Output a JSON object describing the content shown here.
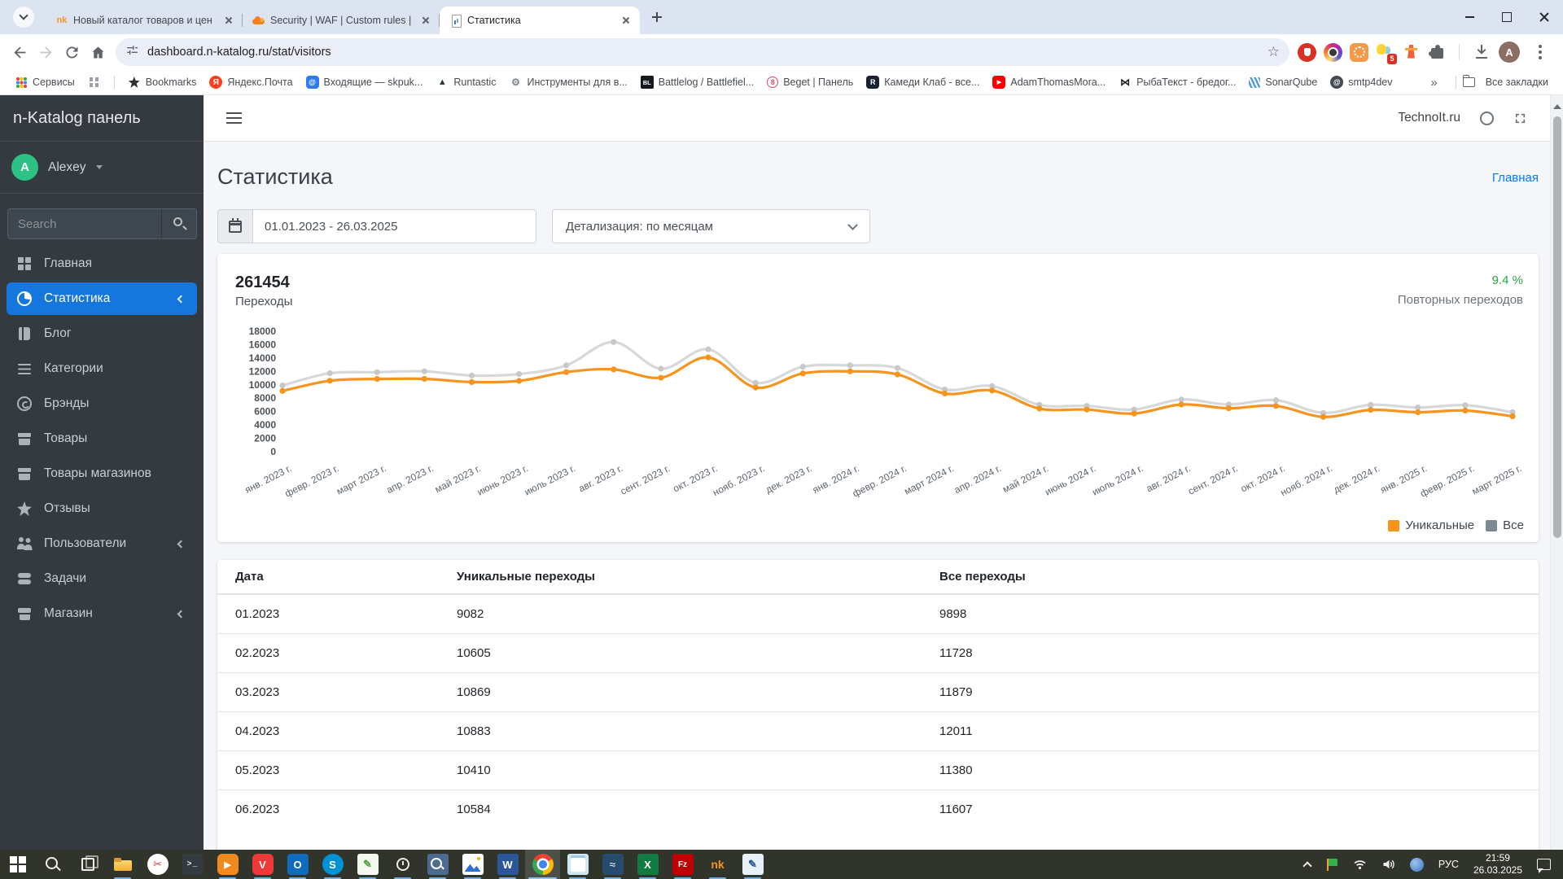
{
  "browser": {
    "tabs": [
      {
        "title": "Новый каталог товаров и цен",
        "favicon": "nk",
        "favicon_glyph": "nk",
        "active": false
      },
      {
        "title": "Security | WAF | Custom rules | ",
        "favicon": "cloudflare",
        "favicon_glyph": "",
        "active": false
      },
      {
        "title": "Статистика",
        "favicon": "stats",
        "favicon_glyph": "",
        "active": true
      }
    ],
    "url": "dashboard.n-katalog.ru/stat/visitors",
    "extension_badge": "5",
    "profile_initial": "A",
    "bookmarks": [
      {
        "label": "Сервисы",
        "icon": "google-apps",
        "glyph": ""
      },
      {
        "label": "",
        "icon": "grid-gray",
        "glyph": "",
        "divider_after": true
      },
      {
        "label": "Bookmarks",
        "icon": "star-black",
        "glyph": ""
      },
      {
        "label": "Яндекс.Почта",
        "icon": "ya-red",
        "glyph": "Я"
      },
      {
        "label": "Входящие — skpuk...",
        "icon": "at-blue",
        "glyph": "@"
      },
      {
        "label": "Runtastic",
        "icon": "runtastic",
        "glyph": "▲"
      },
      {
        "label": "Инструменты для в...",
        "icon": "tools",
        "glyph": "⚙"
      },
      {
        "label": "Battlelog / Battlefiel...",
        "icon": "bl-black",
        "glyph": "BL"
      },
      {
        "label": "Beget | Панель",
        "icon": "beget",
        "glyph": "8"
      },
      {
        "label": "Камеди Клаб - все...",
        "icon": "kk-dark",
        "glyph": "R"
      },
      {
        "label": "AdamThomasMora...",
        "icon": "youtube",
        "glyph": "▶"
      },
      {
        "label": "РыбаТекст - бредог...",
        "icon": "butterfly",
        "glyph": "⋈"
      },
      {
        "label": "SonarQube",
        "icon": "sonarqube",
        "glyph": ""
      },
      {
        "label": "smtp4dev",
        "icon": "smtp",
        "glyph": "@"
      }
    ],
    "overflow_glyph": "»",
    "all_bookmarks": "Все закладки"
  },
  "sidebar": {
    "brand": "n-Katalog панель",
    "user_initial": "A",
    "user_name": "Alexey",
    "search_placeholder": "Search",
    "items": [
      {
        "label": "Главная",
        "icon": "grid"
      },
      {
        "label": "Статистика",
        "icon": "chart-pie",
        "active": true,
        "chevron": true
      },
      {
        "label": "Блог",
        "icon": "book"
      },
      {
        "label": "Категории",
        "icon": "list"
      },
      {
        "label": "Брэнды",
        "icon": "copyright"
      },
      {
        "label": "Товары",
        "icon": "box"
      },
      {
        "label": "Товары магазинов",
        "icon": "box"
      },
      {
        "label": "Отзывы",
        "icon": "star"
      },
      {
        "label": "Пользователи",
        "icon": "users",
        "chevron": true
      },
      {
        "label": "Задачи",
        "icon": "tasks"
      },
      {
        "label": "Магазин",
        "icon": "store",
        "chevron": true
      }
    ]
  },
  "topbar": {
    "site": "TechnoIt.ru"
  },
  "page": {
    "title": "Статистика",
    "breadcrumb": "Главная",
    "date_range": "01.01.2023 - 26.03.2025",
    "detail": "Детализация: по месяцам",
    "total": "261454",
    "total_label": "Переходы",
    "repeat_percent": "9.4 %",
    "repeat_label": "Повторных переходов"
  },
  "chart_data": {
    "type": "line",
    "title": "Переходы",
    "x_labels": [
      "янв. 2023 г.",
      "февр. 2023 г.",
      "март 2023 г.",
      "апр. 2023 г.",
      "май 2023 г.",
      "июнь 2023 г.",
      "июль 2023 г.",
      "авг. 2023 г.",
      "сент. 2023 г.",
      "окт. 2023 г.",
      "нояб. 2023 г.",
      "дек. 2023 г.",
      "янв. 2024 г.",
      "февр. 2024 г.",
      "март 2024 г.",
      "апр. 2024 г.",
      "май 2024 г.",
      "июнь 2024 г.",
      "июль 2024 г.",
      "авг. 2024 г.",
      "сент. 2024 г.",
      "окт. 2024 г.",
      "нояб. 2024 г.",
      "дек. 2024 г.",
      "янв. 2025 г.",
      "февр. 2025 г.",
      "март 2025 г."
    ],
    "series": [
      {
        "name": "Уникальные",
        "color": "#f7941e",
        "dot": "#f7941e",
        "legend_color": "#f7941e",
        "values": [
          9082,
          10605,
          10869,
          10883,
          10410,
          10584,
          11900,
          12300,
          11050,
          14100,
          9600,
          11700,
          12000,
          11550,
          8700,
          9150,
          6450,
          6300,
          5700,
          7050,
          6500,
          6850,
          5200,
          6250,
          5900,
          6150,
          5300
        ]
      },
      {
        "name": "Все",
        "color": "#d6d8da",
        "dot": "#c6c9cc",
        "legend_color": "#7d8893",
        "values": [
          9898,
          11728,
          11879,
          12011,
          11380,
          11607,
          12900,
          16400,
          12400,
          15300,
          10300,
          12700,
          12900,
          12500,
          9300,
          9800,
          7000,
          6850,
          6300,
          7800,
          7050,
          7700,
          5800,
          7000,
          6600,
          6950,
          5900
        ]
      }
    ],
    "ylim": [
      0,
      18000
    ],
    "ytick_step": 2000,
    "grid": false,
    "legend_position": "bottom-right"
  },
  "table": {
    "headers": [
      "Дата",
      "Уникальные переходы",
      "Все переходы"
    ],
    "rows": [
      [
        "01.2023",
        "9082",
        "9898"
      ],
      [
        "02.2023",
        "10605",
        "11728"
      ],
      [
        "03.2023",
        "10869",
        "11879"
      ],
      [
        "04.2023",
        "10883",
        "12011"
      ],
      [
        "05.2023",
        "10410",
        "11380"
      ],
      [
        "06.2023",
        "10584",
        "11607"
      ]
    ]
  },
  "taskbar": {
    "icons": [
      {
        "name": "start",
        "glyph": "",
        "running": false
      },
      {
        "name": "search-task",
        "glyph": "",
        "running": false
      },
      {
        "name": "task-view",
        "glyph": "",
        "running": false
      },
      {
        "name": "file-explorer",
        "glyph": "",
        "running": true
      },
      {
        "name": "screenhunter",
        "glyph": "✂",
        "running": false
      },
      {
        "name": "terminal",
        "glyph": ">_",
        "bg": "#333b40",
        "fg": "#e8eaed",
        "running": false
      },
      {
        "name": "media-player",
        "glyph": "▶",
        "bg": "#f28a1e",
        "fg": "#fff",
        "running": true
      },
      {
        "name": "vivaldi",
        "glyph": "V",
        "bg": "#ef3939",
        "fg": "#fff",
        "running": true
      },
      {
        "name": "outlook",
        "glyph": "O",
        "bg": "#0f6cbd",
        "fg": "#fff",
        "running": true
      },
      {
        "name": "skype",
        "glyph": "S",
        "bg": "#0092d7",
        "fg": "#fff",
        "running": true
      },
      {
        "name": "notepad",
        "glyph": "✎",
        "bg": "#f4f8ef",
        "fg": "#4ea53c",
        "running": true
      },
      {
        "name": "timer",
        "glyph": "",
        "running": true
      },
      {
        "name": "screen-magnifier",
        "glyph": "",
        "running": true
      },
      {
        "name": "photos",
        "glyph": "",
        "running": true
      },
      {
        "name": "word",
        "glyph": "W",
        "bg": "#2b579a",
        "fg": "#fff",
        "running": true
      },
      {
        "name": "chrome",
        "glyph": "",
        "running": true,
        "active": true
      },
      {
        "name": "notes",
        "glyph": "",
        "running": true
      },
      {
        "name": "ssms",
        "glyph": "≈",
        "bg": "#274b6d",
        "fg": "#fff",
        "running": true
      },
      {
        "name": "excel",
        "glyph": "X",
        "bg": "#107c41",
        "fg": "#fff",
        "running": true
      },
      {
        "name": "filezilla",
        "glyph": "Fz",
        "bg": "#bf0000",
        "fg": "#fff",
        "running": true
      },
      {
        "name": "nk-app",
        "glyph": "nk",
        "bg": "transparent",
        "fg": "#f7941e",
        "running": true
      },
      {
        "name": "paint",
        "glyph": "✎",
        "bg": "#e8f1fa",
        "fg": "#2b579a",
        "running": true
      }
    ],
    "tray": {
      "lang": "РУС",
      "time": "21:59",
      "date": "26.03.2025"
    }
  }
}
